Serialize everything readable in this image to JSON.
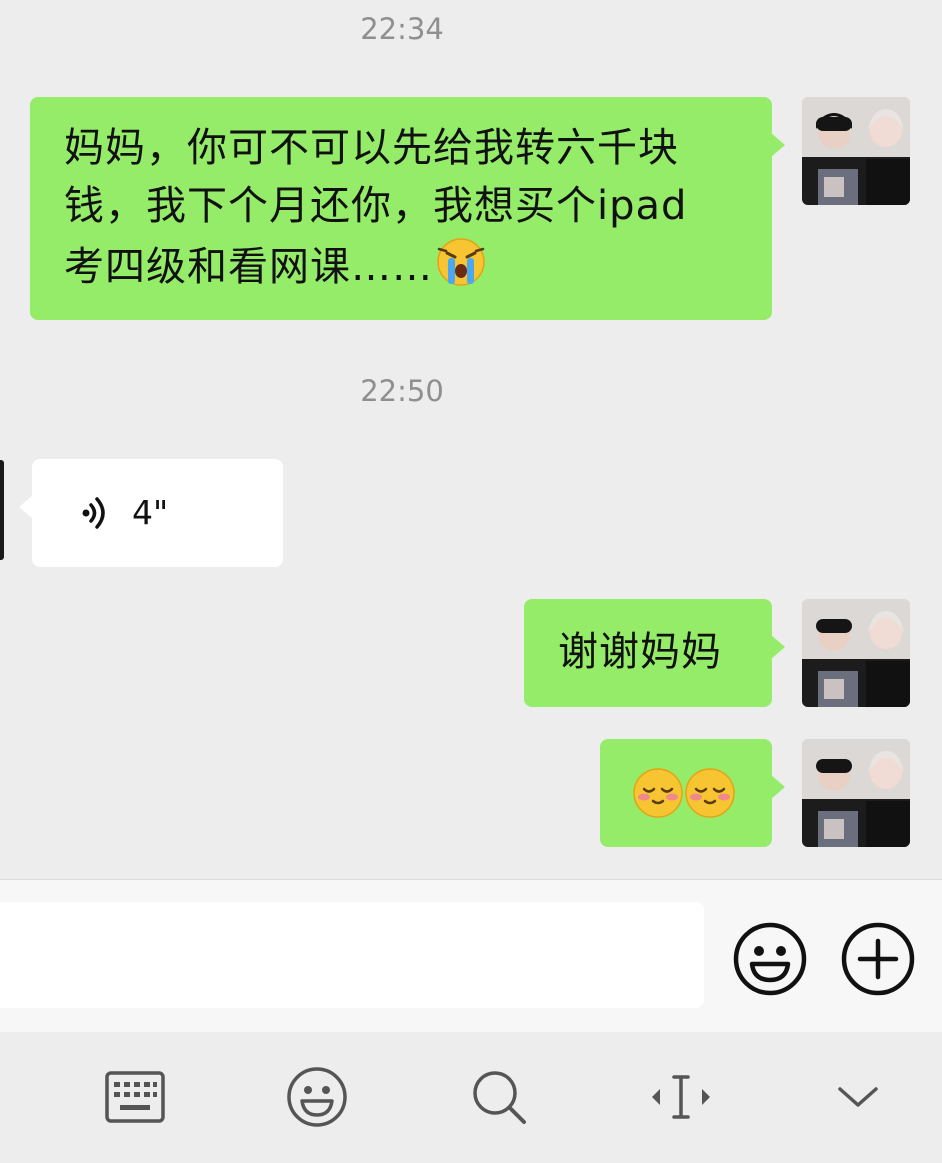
{
  "chat": {
    "timestamp_1": "22:34",
    "timestamp_2": "22:50",
    "msg1_line1": "妈妈，你可不可以先给我转六千块",
    "msg1_line2": "钱，我下个月还你，我想买个ipad",
    "msg1_line3": "考四级和看网课……",
    "msg1_emoji": "loudly-crying-face",
    "voice_duration": "4\"",
    "msg3": "谢谢妈妈",
    "msg4_emoji": "smiling-face-with-closed-eyes-blush"
  },
  "input": {
    "placeholder": "",
    "emoji_button": "smiley-icon",
    "plus_button": "plus-circle-icon"
  },
  "keyboard_toolbar": {
    "icons": [
      "keyboard-icon",
      "emoji-icon",
      "search-icon",
      "cursor-move-icon",
      "collapse-chevron-icon"
    ]
  },
  "colors": {
    "background": "#ededed",
    "sent_bubble": "#95ec69",
    "received_bubble": "#ffffff",
    "timestamp_text": "#8f8f8f"
  }
}
